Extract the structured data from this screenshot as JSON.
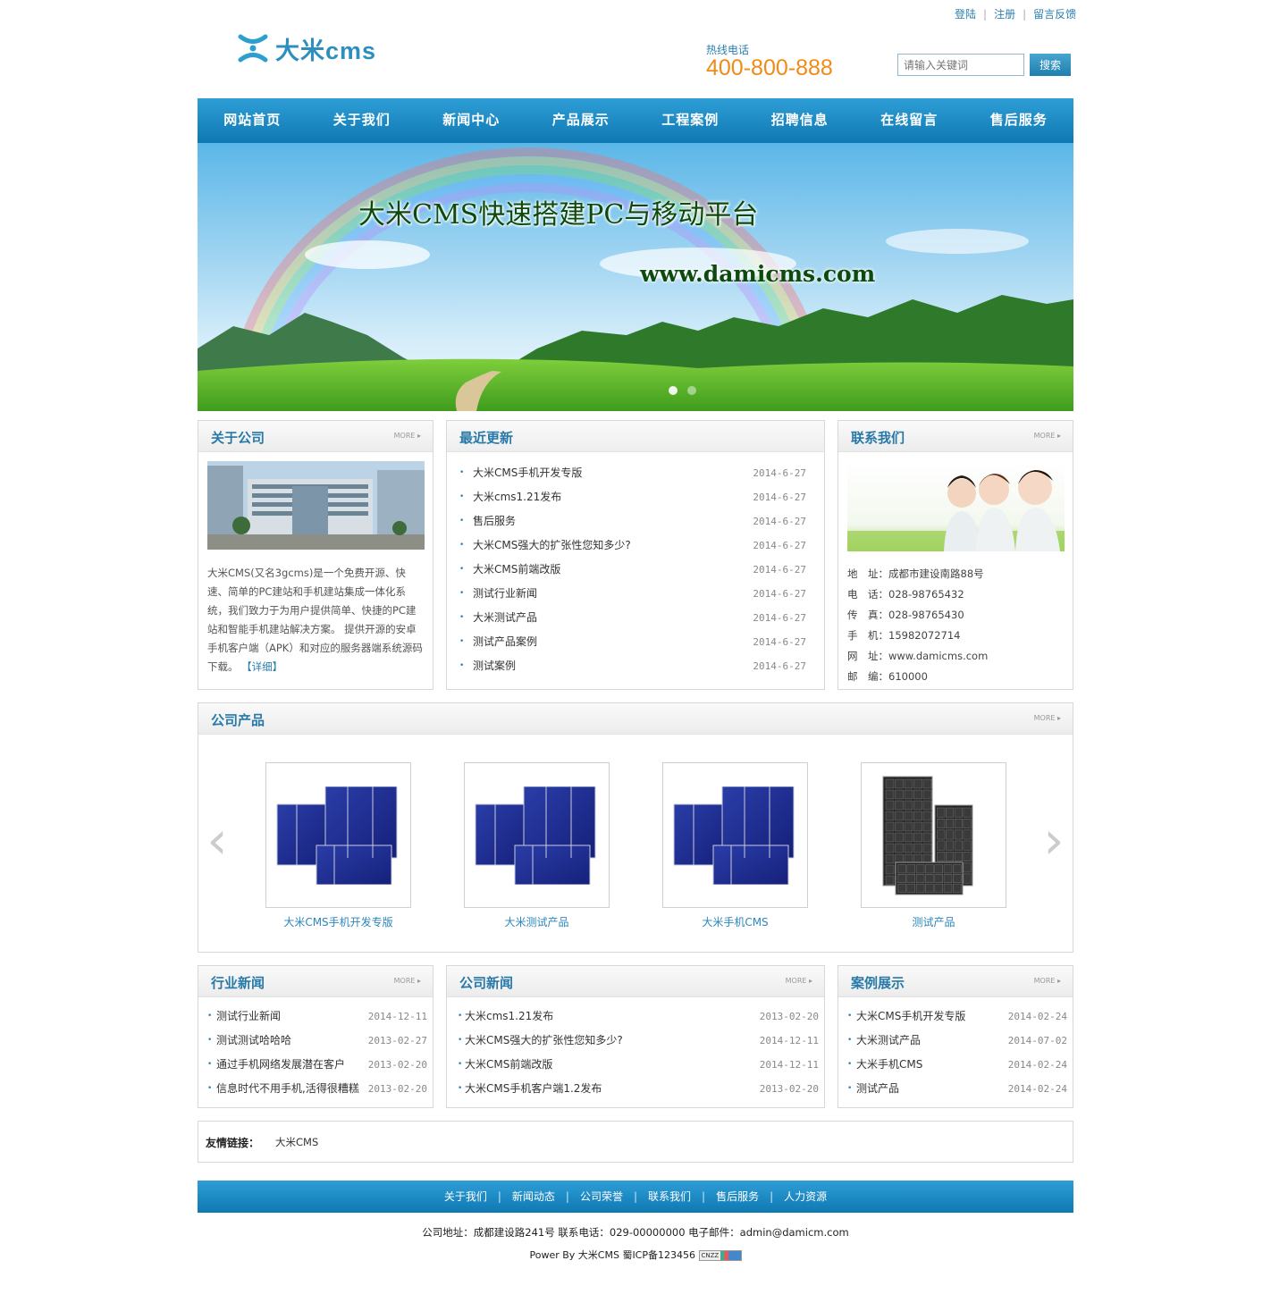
{
  "top_links": [
    "登陆",
    "注册",
    "留言反馈"
  ],
  "logo_text": "大米cms",
  "hotline": {
    "label": "热线电话",
    "number": "400-800-888"
  },
  "search": {
    "placeholder": "请输入关键词",
    "button": "搜索"
  },
  "nav": [
    "网站首页",
    "关于我们",
    "新闻中心",
    "产品展示",
    "工程案例",
    "招聘信息",
    "在线留言",
    "售后服务"
  ],
  "banner": {
    "title": "大米CMS快速搭建PC与移动平台",
    "url": "www.damicms.com",
    "slides": 2,
    "active_slide": 1
  },
  "more_label": "MORE ▸",
  "about": {
    "title": "关于公司",
    "text": "大米CMS(又名3gcms)是一个免费开源、快速、简单的PC建站和手机建站集成一体化系统，我们致力于为用户提供简单、快捷的PC建站和智能手机建站解决方案。 提供开源的安卓手机客户端（APK）和对应的服务器端系统源码下载。",
    "detail_link": "【详细】"
  },
  "recent": {
    "title": "最近更新",
    "items": [
      {
        "title": "大米CMS手机开发专版",
        "date": "2014-6-27"
      },
      {
        "title": "大米cms1.21发布",
        "date": "2014-6-27"
      },
      {
        "title": "售后服务",
        "date": "2014-6-27"
      },
      {
        "title": "大米CMS强大的扩张性您知多少?",
        "date": "2014-6-27"
      },
      {
        "title": "大米CMS前端改版",
        "date": "2014-6-27"
      },
      {
        "title": "测试行业新闻",
        "date": "2014-6-27"
      },
      {
        "title": "大米测试产品",
        "date": "2014-6-27"
      },
      {
        "title": "测试产品案例",
        "date": "2014-6-27"
      },
      {
        "title": "测试案例",
        "date": "2014-6-27"
      }
    ]
  },
  "contact": {
    "title": "联系我们",
    "lines": [
      "地　址：成都市建设南路88号",
      "电　话：028-98765432",
      "传　真：028-98765430",
      "手　机：15982072714",
      "网　址：www.damicms.com",
      "邮　编：610000"
    ]
  },
  "products": {
    "title": "公司产品",
    "items": [
      {
        "name": "大米CMS手机开发专版",
        "icon": "solar-cell-blue"
      },
      {
        "name": "大米测试产品",
        "icon": "solar-cell-blue"
      },
      {
        "name": "大米手机CMS",
        "icon": "solar-cell-blue"
      },
      {
        "name": "测试产品",
        "icon": "solar-panel-black"
      }
    ]
  },
  "industry_news": {
    "title": "行业新闻",
    "items": [
      {
        "title": "测试行业新闻",
        "date": "2014-12-11"
      },
      {
        "title": "测试测试哈哈哈",
        "date": "2013-02-27"
      },
      {
        "title": "通过手机网络发展潜在客户",
        "date": "2013-02-20"
      },
      {
        "title": "信息时代不用手机,活得很糟糕",
        "date": "2013-02-20"
      }
    ]
  },
  "company_news": {
    "title": "公司新闻",
    "items": [
      {
        "title": "大米cms1.21发布",
        "date": "2013-02-20"
      },
      {
        "title": "大米CMS强大的扩张性您知多少?",
        "date": "2014-12-11"
      },
      {
        "title": "大米CMS前端改版",
        "date": "2014-12-11"
      },
      {
        "title": "大米CMS手机客户端1.2发布",
        "date": "2013-02-20"
      }
    ]
  },
  "cases": {
    "title": "案例展示",
    "items": [
      {
        "title": "大米CMS手机开发专版",
        "date": "2014-02-24"
      },
      {
        "title": "大米测试产品",
        "date": "2014-07-02"
      },
      {
        "title": "大米手机CMS",
        "date": "2014-02-24"
      },
      {
        "title": "测试产品",
        "date": "2014-02-24"
      }
    ]
  },
  "friend_links": {
    "label": "友情链接：",
    "items": [
      "大米CMS"
    ]
  },
  "footer": {
    "links": [
      "关于我们",
      "新闻动态",
      "公司荣誉",
      "联系我们",
      "售后服务",
      "人力资源"
    ],
    "address_line": "公司地址：成都建设路241号 联系电话：029-00000000 电子邮件：admin@damicm.com",
    "power_line": "Power By 大米CMS  蜀ICP备123456",
    "badge": "CNZZ"
  },
  "colors": {
    "brand_blue": "#1a86c2",
    "accent_orange": "#f28a16",
    "link_blue": "#2a86bd"
  }
}
